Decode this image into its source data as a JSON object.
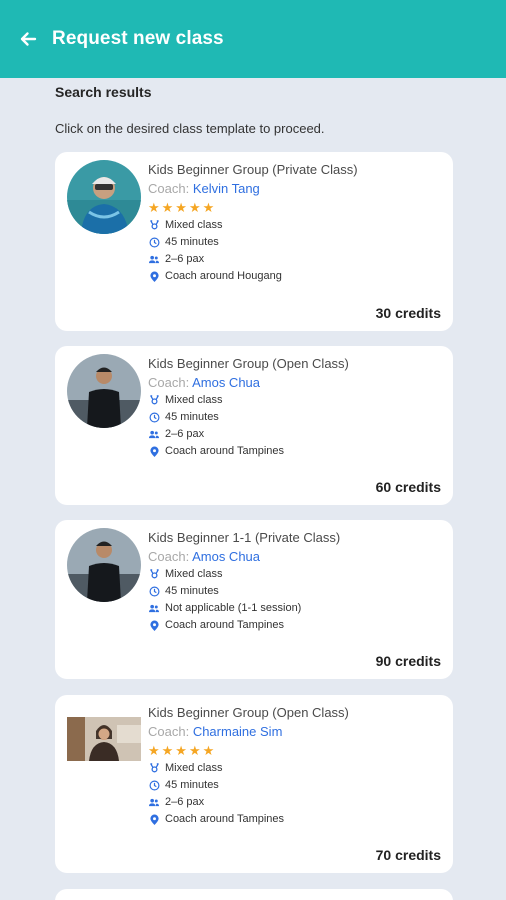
{
  "header": {
    "title": "Request new class"
  },
  "section_title": "Search results",
  "hint": "Click on the desired class template to proceed.",
  "coach_prefix": "Coach: ",
  "colors": {
    "appbar": "#1fb9b4",
    "link": "#2f6fe0",
    "star": "#f5a623",
    "icon": "#2f6fe0",
    "background": "#e4e9f1"
  },
  "icons": {
    "back": "arrow-left-icon",
    "gender": "gender-icon",
    "duration": "clock-icon",
    "pax": "people-icon",
    "location": "location-pin-icon",
    "rating": "star-icon"
  },
  "cards": [
    {
      "title": "Kids Beginner Group (Private Class)",
      "coach": "Kelvin  Tang",
      "stars": "★★★★★",
      "gender": "Mixed class",
      "duration": "45 minutes",
      "pax": "2–6 pax",
      "location": "Coach around Hougang",
      "credits": "30 credits"
    },
    {
      "title": "Kids Beginner Group (Open Class)",
      "coach": "Amos  Chua",
      "stars": "",
      "gender": "Mixed class",
      "duration": "45 minutes",
      "pax": "2–6 pax",
      "location": "Coach around Tampines",
      "credits": "60 credits"
    },
    {
      "title": "Kids Beginner 1-1 (Private Class)",
      "coach": "Amos  Chua",
      "stars": "",
      "gender": "Mixed class",
      "duration": "45 minutes",
      "pax": "Not applicable (1-1 session)",
      "location": "Coach around Tampines",
      "credits": "90 credits"
    },
    {
      "title": "Kids Beginner Group (Open Class)",
      "coach": "Charmaine Sim",
      "stars": "★★★★★",
      "gender": "Mixed class",
      "duration": "45 minutes",
      "pax": "2–6 pax",
      "location": "Coach around Tampines",
      "credits": "70 credits"
    }
  ]
}
